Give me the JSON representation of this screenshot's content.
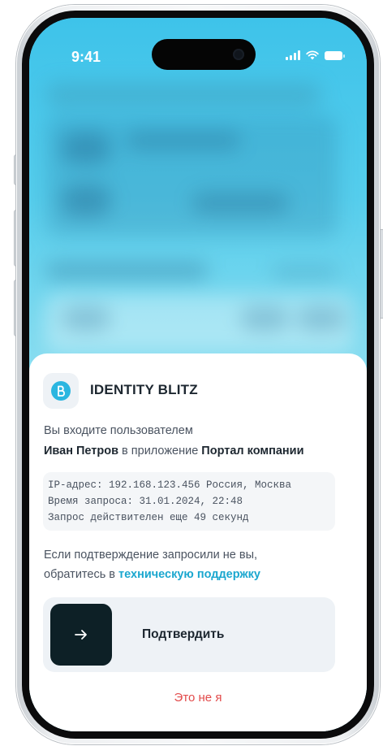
{
  "status_bar": {
    "time": "9:41"
  },
  "app": {
    "name": "IDENTITY BLITZ",
    "logo_color": "#2bb6e0"
  },
  "request": {
    "intro": "Вы входите пользователем",
    "user_name": "Иван Петров",
    "in_app_text": " в приложение ",
    "target_app": "Портал компании",
    "ip_line": "IP-адрес: 192.168.123.456 Россия, Москва",
    "time_line": "Время запроса: 31.01.2024, 22:48",
    "valid_line": "Запрос действителен еще 49 секунд"
  },
  "warning": {
    "line1": "Если подтверждение запросили не вы,",
    "line2_prefix": "обратитесь в ",
    "support_link": "техническую поддержку"
  },
  "actions": {
    "confirm_label": "Подтвердить",
    "decline_label": "Это не я"
  },
  "colors": {
    "accent": "#1ba7cf",
    "danger": "#e24a4a",
    "confirm_button_bg": "#0d2026"
  },
  "icons": {
    "confirm": "arrow-right-icon",
    "logo": "identity-blitz-logo-icon",
    "signal": "cellular-signal-icon",
    "wifi": "wifi-icon",
    "battery": "battery-icon"
  }
}
